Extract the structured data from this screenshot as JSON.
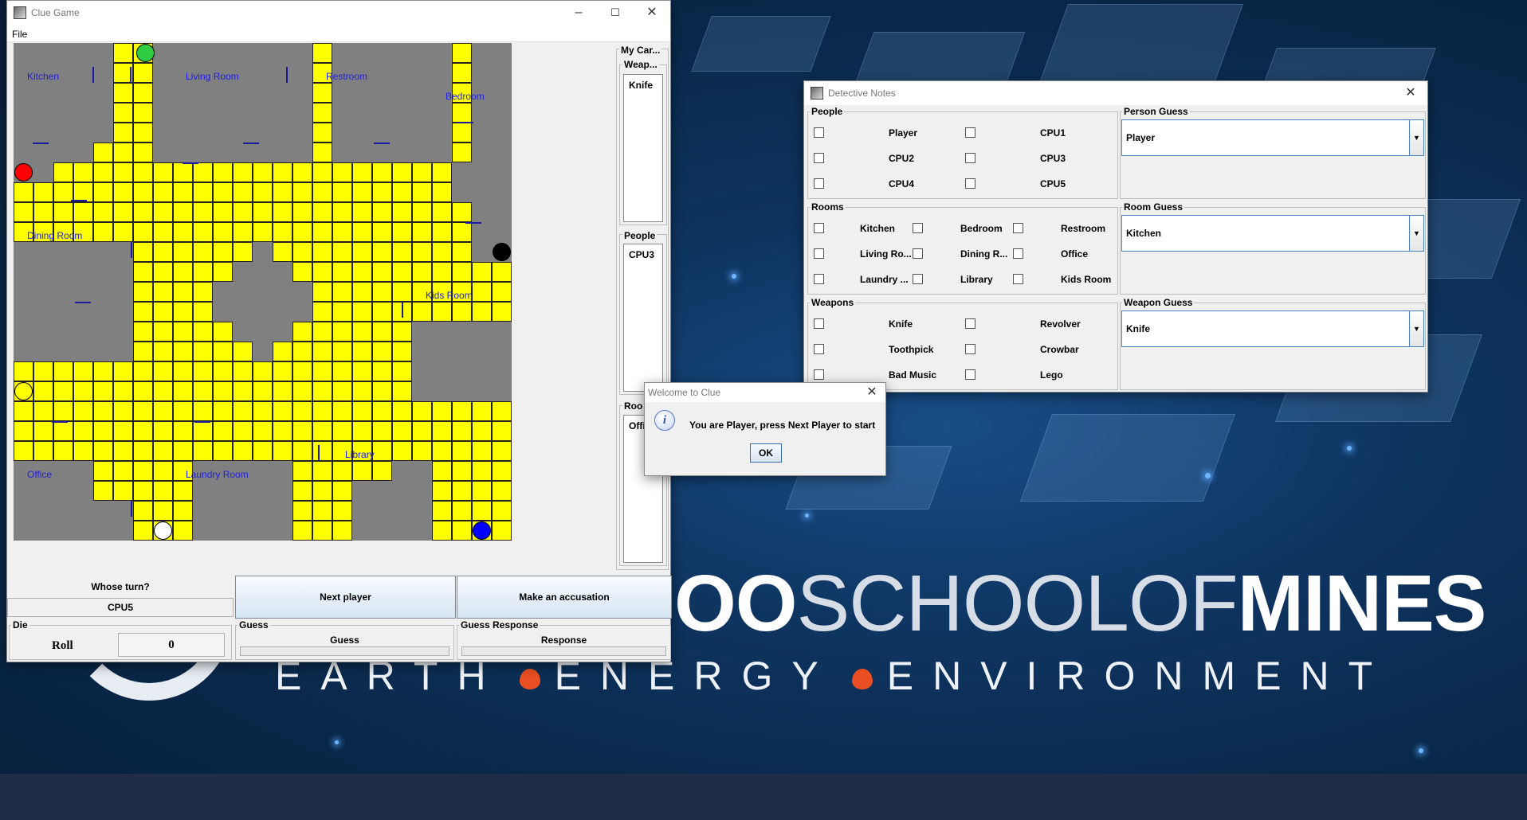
{
  "desktop": {
    "brand_oo": "OO",
    "brand_school": "SCHOOLOF",
    "brand_mines": "MINES",
    "tagline_earth": "EARTH",
    "tagline_energy": "ENERGY",
    "tagline_environment": "ENVIRONMENT"
  },
  "clue_window": {
    "title": "Clue Game",
    "menu_file": "File",
    "rooms": {
      "kitchen": "Kitchen",
      "living_room": "Living Room",
      "restroom": "Restroom",
      "bedroom": "Bedroom",
      "dining_room": "Dining Room",
      "kids_room": "Kids Room",
      "office": "Office",
      "laundry_room": "Laundry Room",
      "library": "Library"
    },
    "pieces": [
      {
        "color": "#2ecc40"
      },
      {
        "color": "#ff0000"
      },
      {
        "color": "#000000"
      },
      {
        "color": "#ffff00"
      },
      {
        "color": "#ffffff"
      },
      {
        "color": "#0000ff"
      }
    ],
    "my_cards_label": "My Car...",
    "weapons_label": "Weap...",
    "weapon_card": "Knife",
    "people_label": "People",
    "people_card": "CPU3",
    "rooms_label": "Roo",
    "room_card": "Offi",
    "whose_turn_label": "Whose turn?",
    "whose_turn_value": "CPU5",
    "next_player": "Next player",
    "make_accusation": "Make an accusation",
    "die_label": "Die",
    "roll_label": "Roll",
    "roll_value": "0",
    "guess_label": "Guess",
    "guess_value": "Guess",
    "guess_response_label": "Guess Response",
    "response_value": "Response"
  },
  "notes_window": {
    "title": "Detective Notes",
    "people_label": "People",
    "people": [
      "Player",
      "CPU1",
      "CPU2",
      "CPU3",
      "CPU4",
      "CPU5"
    ],
    "rooms_label": "Rooms",
    "rooms": [
      "Kitchen",
      "Bedroom",
      "Restroom",
      "Living Ro...",
      "Dining R...",
      "Office",
      "Laundry ...",
      "Library",
      "Kids Room"
    ],
    "weapons_label": "Weapons",
    "weapons": [
      "Knife",
      "Revolver",
      "Toothpick",
      "Crowbar",
      "Bad Music",
      "Lego"
    ],
    "person_guess_label": "Person Guess",
    "person_guess_value": "Player",
    "room_guess_label": "Room Guess",
    "room_guess_value": "Kitchen",
    "weapon_guess_label": "Weapon Guess",
    "weapon_guess_value": "Knife"
  },
  "dialog": {
    "title": "Welcome to Clue",
    "message": "You are Player, press Next Player to start",
    "ok": "OK"
  }
}
